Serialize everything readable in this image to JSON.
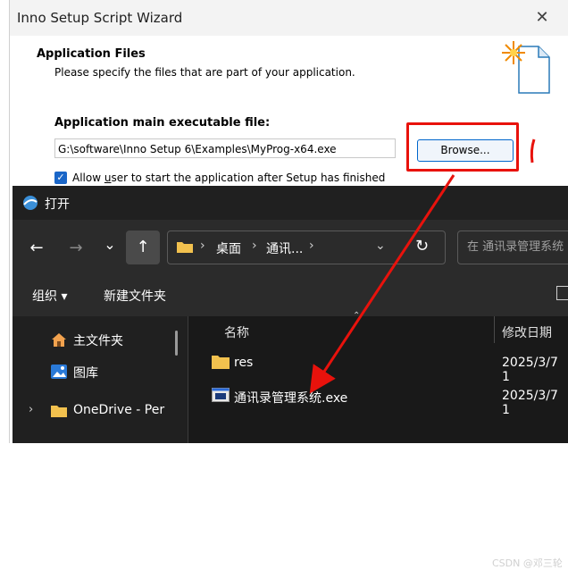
{
  "wizard": {
    "title": "Inno Setup Script Wizard",
    "close_glyph": "✕",
    "heading": "Application Files",
    "subheading": "Please specify the files that are part of your application.",
    "field_label": "Application main executable file:",
    "exe_path": "G:\\software\\Inno Setup 6\\Examples\\MyProg-x64.exe",
    "browse_label": "Browse...",
    "allow_checked": true,
    "allow_label_pre": "Allow ",
    "allow_label_u": "u",
    "allow_label_post": "ser to start the application after Setup has finished",
    "doc_icon": "document-star-icon"
  },
  "annotation": {
    "highlight_color": "#e8120c"
  },
  "dialog": {
    "title": "打开",
    "nav": {
      "back_icon": "←",
      "forward_icon": "→",
      "recent_icon": "⌄",
      "up_icon": "↑"
    },
    "address": {
      "segments": [
        "桌面",
        "通讯..."
      ],
      "separator": "›",
      "dropdown_icon": "⌄",
      "refresh_icon": "↻"
    },
    "search_placeholder": "在 通讯录管理系统",
    "toolbar": {
      "organize": "组织 ▾",
      "new_folder": "新建文件夹"
    },
    "sidebar": [
      {
        "label": "主文件夹",
        "icon": "home-icon"
      },
      {
        "label": "图库",
        "icon": "gallery-icon"
      },
      {
        "label": "OneDrive - Per",
        "icon": "folder-icon",
        "expand": "›"
      }
    ],
    "columns": {
      "name": "名称",
      "modified": "修改日期"
    },
    "files": [
      {
        "name": "res",
        "date": "2025/3/7 1",
        "icon": "folder-icon"
      },
      {
        "name": "通讯录管理系统.exe",
        "date": "2025/3/7 1",
        "icon": "exe-icon"
      }
    ],
    "watermark": "CSDN @邓三轮"
  }
}
